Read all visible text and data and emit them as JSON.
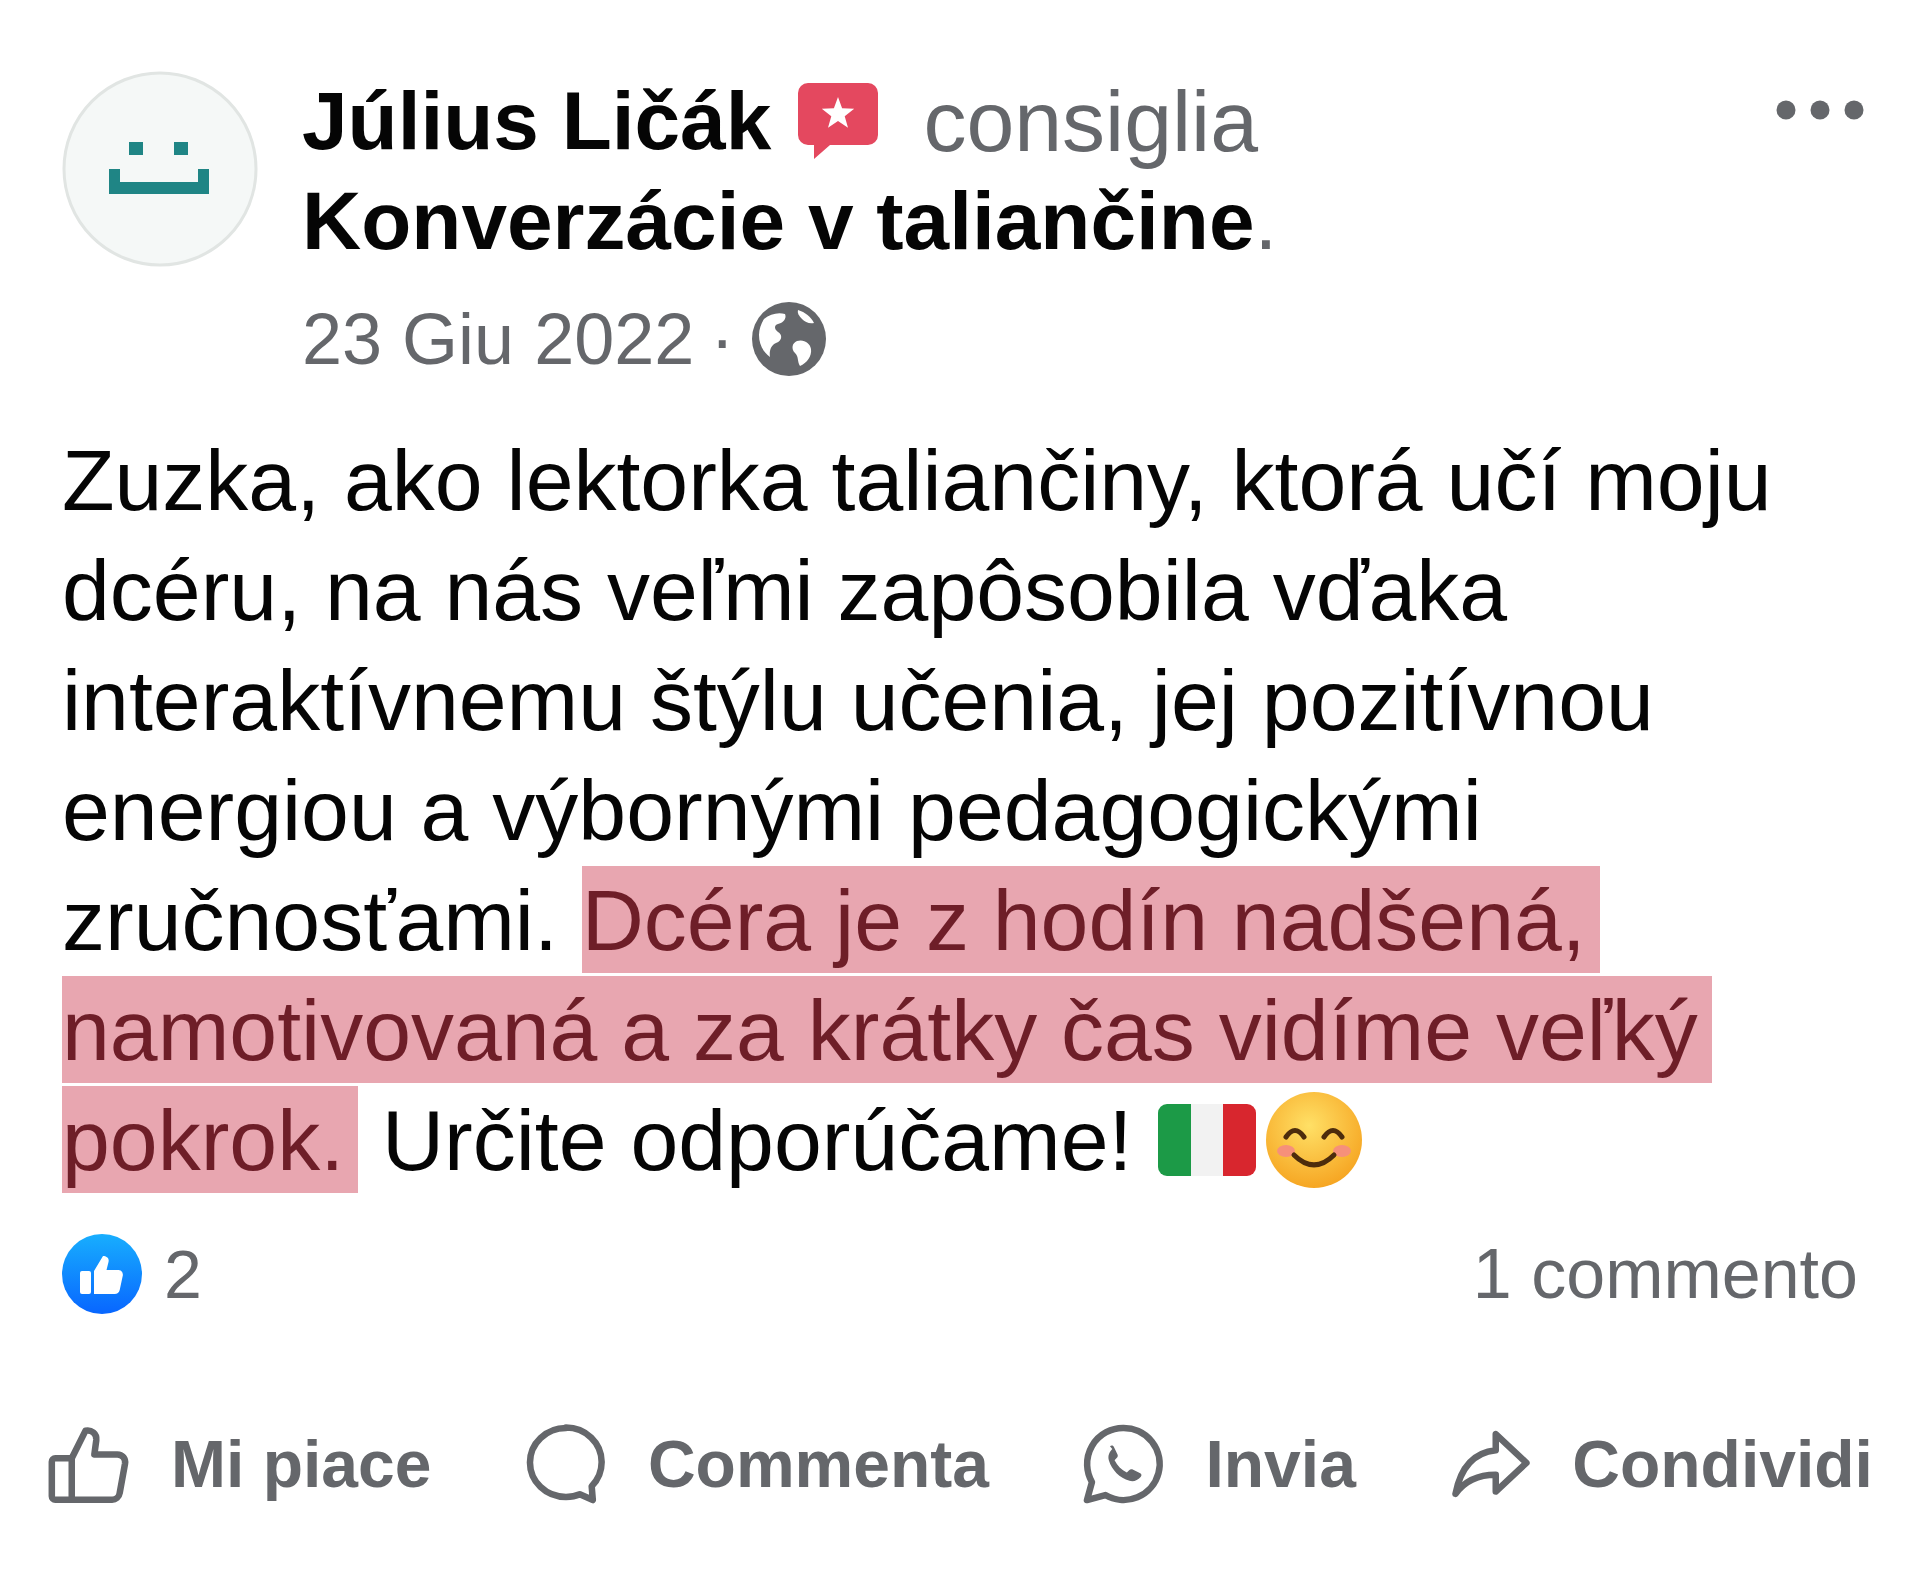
{
  "post": {
    "header": {
      "author": "Július Ličák",
      "verb": "consiglia",
      "page": "Konverzácie v taliančine",
      "punctuation": ".",
      "date": "23 Giu 2022",
      "separator": "·"
    },
    "body": [
      {
        "text": "Zuzka, ako lektorka taliančiny, ktorá učí moju dcéru, na nás veľmi zapôsobila vďaka interaktívnemu štýlu učenia, jej pozitívnou energiou a výbornými pedagogickými zručnosťami.",
        "highlighted": false
      },
      {
        "text": "Dcéra je z hodín nadšená, namotivovaná a za krátky čas vidíme veľký pokrok.",
        "highlighted": true
      },
      {
        "text": "Určite odporúčame!",
        "highlighted": false
      }
    ],
    "reactions_count": "2",
    "comments": "1 commento",
    "actions": [
      {
        "kind": "like",
        "label": "Mi piace"
      },
      {
        "kind": "comment",
        "label": "Commenta"
      },
      {
        "kind": "send",
        "label": "Invia"
      },
      {
        "kind": "share",
        "label": "Condividi"
      }
    ]
  }
}
